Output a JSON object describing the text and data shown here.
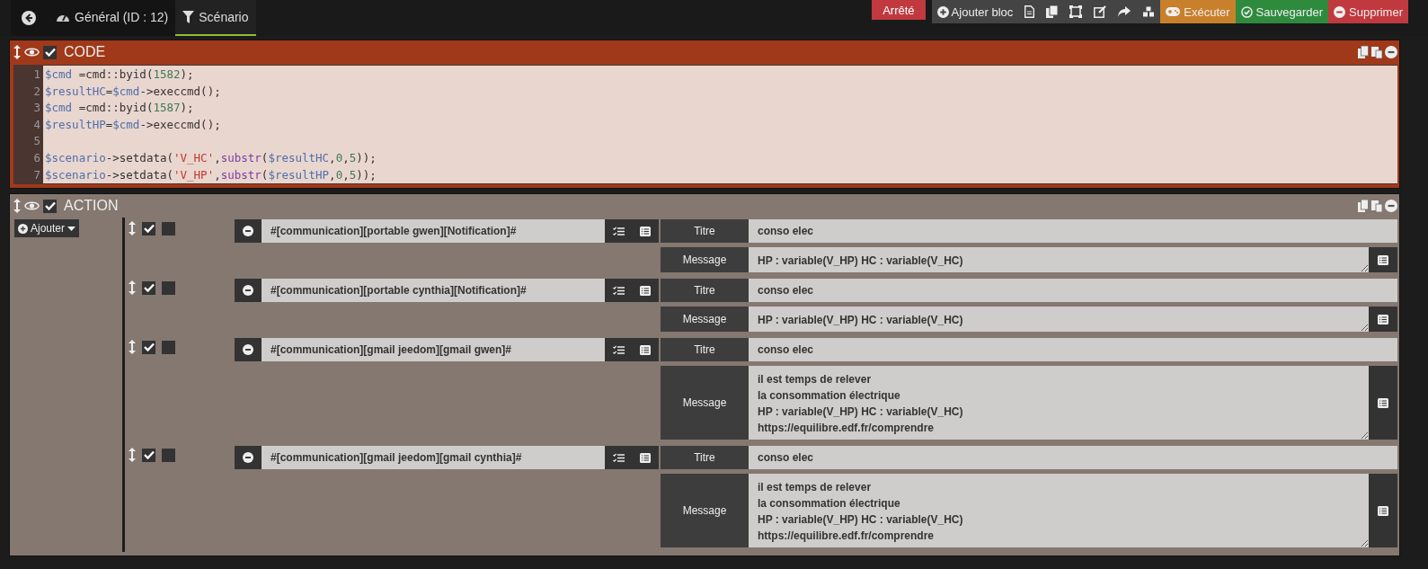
{
  "tabs": [
    {
      "label": "Général (ID : 12)",
      "selected": false
    },
    {
      "label": "Scénario",
      "selected": true
    }
  ],
  "status": {
    "label": "Arrêté",
    "kind": "stopped"
  },
  "toolbar": {
    "add_block": "Ajouter bloc",
    "actions": [
      {
        "label": "Exécuter",
        "kind": "run"
      },
      {
        "label": "Sauvegarder",
        "kind": "save"
      },
      {
        "label": "Supprimer",
        "kind": "delete"
      }
    ]
  },
  "blocks": [
    {
      "kind": "code",
      "title": "CODE",
      "enabled": true,
      "lines": [
        {
          "no": "1",
          "tokens": [
            {
              "text": "$cmd",
              "kind": "var"
            },
            {
              "text": " =cmd::byid(",
              "kind": "plain"
            },
            {
              "text": "1582",
              "kind": "num"
            },
            {
              "text": ");",
              "kind": "plain"
            }
          ]
        },
        {
          "no": "2",
          "tokens": [
            {
              "text": "$resultHC",
              "kind": "var"
            },
            {
              "text": "=",
              "kind": "plain"
            },
            {
              "text": "$cmd",
              "kind": "var"
            },
            {
              "text": "->execcmd();",
              "kind": "plain"
            }
          ]
        },
        {
          "no": "3",
          "tokens": [
            {
              "text": "$cmd",
              "kind": "var"
            },
            {
              "text": " =cmd::byid(",
              "kind": "plain"
            },
            {
              "text": "1587",
              "kind": "num"
            },
            {
              "text": ");",
              "kind": "plain"
            }
          ]
        },
        {
          "no": "4",
          "tokens": [
            {
              "text": "$resultHP",
              "kind": "var"
            },
            {
              "text": "=",
              "kind": "plain"
            },
            {
              "text": "$cmd",
              "kind": "var"
            },
            {
              "text": "->execcmd();",
              "kind": "plain"
            }
          ]
        },
        {
          "no": "5"
        },
        {
          "no": "6",
          "tokens": [
            {
              "text": "$scenario",
              "kind": "var"
            },
            {
              "text": "->setdata(",
              "kind": "plain"
            },
            {
              "text": "'V_HC'",
              "kind": "str"
            },
            {
              "text": ",",
              "kind": "plain"
            },
            {
              "text": "substr",
              "kind": "fn"
            },
            {
              "text": "(",
              "kind": "plain"
            },
            {
              "text": "$resultHC",
              "kind": "var"
            },
            {
              "text": ",",
              "kind": "plain"
            },
            {
              "text": "0",
              "kind": "num"
            },
            {
              "text": ",",
              "kind": "plain"
            },
            {
              "text": "5",
              "kind": "num"
            },
            {
              "text": "));",
              "kind": "plain"
            }
          ]
        },
        {
          "no": "7",
          "tokens": [
            {
              "text": "$scenario",
              "kind": "var"
            },
            {
              "text": "->setdata(",
              "kind": "plain"
            },
            {
              "text": "'V_HP'",
              "kind": "str"
            },
            {
              "text": ",",
              "kind": "plain"
            },
            {
              "text": "substr",
              "kind": "fn"
            },
            {
              "text": "(",
              "kind": "plain"
            },
            {
              "text": "$resultHP",
              "kind": "var"
            },
            {
              "text": ",",
              "kind": "plain"
            },
            {
              "text": "0",
              "kind": "num"
            },
            {
              "text": ",",
              "kind": "plain"
            },
            {
              "text": "5",
              "kind": "num"
            },
            {
              "text": "));",
              "kind": "plain"
            }
          ]
        }
      ]
    },
    {
      "kind": "action",
      "title": "ACTION",
      "enabled": true,
      "add_button": "Ajouter",
      "actions": [
        {
          "enabled": true,
          "background": false,
          "command": "#[communication][portable gwen][Notification]#",
          "options": [
            {
              "label": "Titre",
              "value": "conso elec",
              "kind": "input"
            },
            {
              "label": "Message",
              "value": "HP : variable(V_HP) HC : variable(V_HC)",
              "kind": "textarea"
            }
          ]
        },
        {
          "enabled": true,
          "background": false,
          "command": "#[communication][portable cynthia][Notification]#",
          "options": [
            {
              "label": "Titre",
              "value": "conso elec",
              "kind": "input"
            },
            {
              "label": "Message",
              "value": "HP : variable(V_HP) HC : variable(V_HC)",
              "kind": "textarea"
            }
          ]
        },
        {
          "enabled": true,
          "background": false,
          "command": "#[communication][gmail jeedom][gmail gwen]#",
          "options": [
            {
              "label": "Titre",
              "value": "conso elec",
              "kind": "input"
            },
            {
              "label": "Message",
              "value": "il est temps de relever\nla consommation électrique\nHP : variable(V_HP) HC : variable(V_HC)\nhttps://equilibre.edf.fr/comprendre",
              "kind": "textarea"
            }
          ]
        },
        {
          "enabled": true,
          "background": false,
          "command": "#[communication][gmail jeedom][gmail cynthia]#",
          "options": [
            {
              "label": "Titre",
              "value": "conso elec",
              "kind": "input"
            },
            {
              "label": "Message",
              "value": "il est temps de relever\nla consommation électrique\nHP : variable(V_HP) HC : variable(V_HC)\nhttps://equilibre.edf.fr/comprendre",
              "kind": "textarea"
            }
          ]
        }
      ]
    }
  ]
}
